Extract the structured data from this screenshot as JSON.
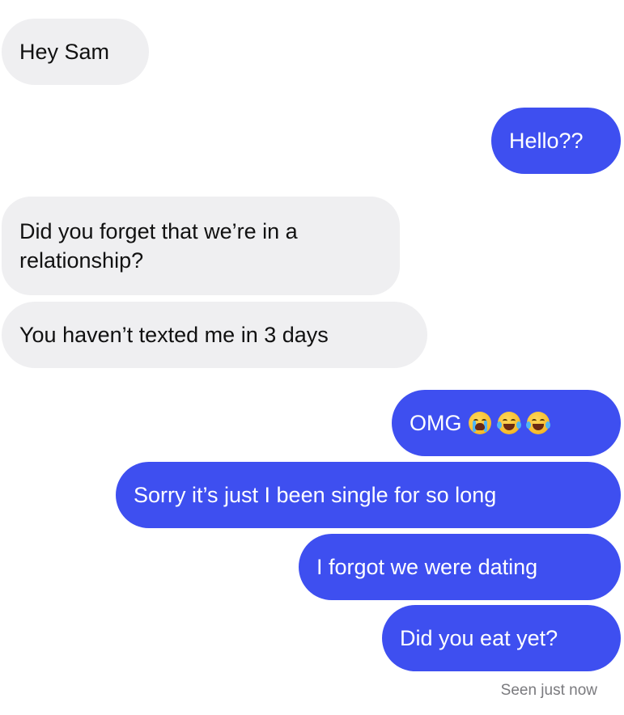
{
  "messages": [
    {
      "direction": "incoming",
      "text": "Hey Sam"
    },
    {
      "direction": "outgoing",
      "text": "Hello??"
    },
    {
      "direction": "incoming",
      "text": "Did you forget that we’re in a relationship?"
    },
    {
      "direction": "incoming",
      "text": "You haven’t texted me in 3 days"
    },
    {
      "direction": "outgoing",
      "text": "OMG",
      "emojis": [
        "loudly-crying-face-icon",
        "face-with-tears-of-joy-icon",
        "face-with-tears-of-joy-icon"
      ]
    },
    {
      "direction": "outgoing",
      "text": "Sorry it’s just I been single for so long"
    },
    {
      "direction": "outgoing",
      "text": "I forgot we were dating"
    },
    {
      "direction": "outgoing",
      "text": "Did you eat yet?"
    }
  ],
  "status": {
    "seen": "Seen just now"
  },
  "colors": {
    "incoming_bubble": "#efeff1",
    "outgoing_bubble": "#3e4ff0",
    "incoming_text": "#111111",
    "outgoing_text": "#ffffff"
  }
}
